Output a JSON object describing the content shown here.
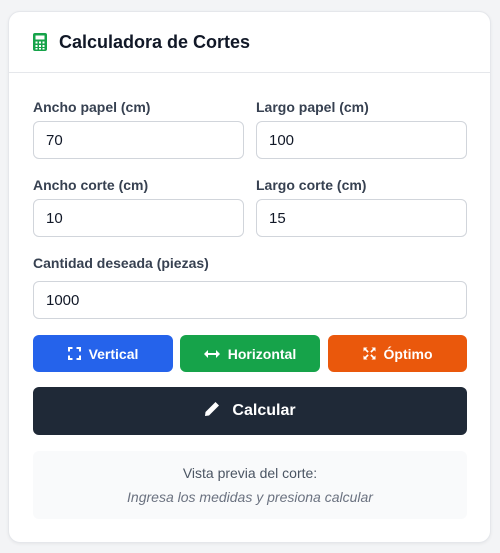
{
  "header": {
    "icon": "calculator-icon",
    "title": "Calculadora de Cortes",
    "icon_color": "#16a34a"
  },
  "form": {
    "paper_width": {
      "label": "Ancho papel (cm)",
      "value": "70"
    },
    "paper_length": {
      "label": "Largo papel (cm)",
      "value": "100"
    },
    "cut_width": {
      "label": "Ancho corte (cm)",
      "value": "10"
    },
    "cut_length": {
      "label": "Largo corte (cm)",
      "value": "15"
    },
    "quantity": {
      "label": "Cantidad deseada (piezas)",
      "value": "1000"
    }
  },
  "modes": {
    "vertical": {
      "label": "Vertical",
      "icon": "expand-icon",
      "color": "#2563eb"
    },
    "horizontal": {
      "label": "Horizontal",
      "icon": "arrows-horizontal-icon",
      "color": "#16a34a"
    },
    "optimo": {
      "label": "Óptimo",
      "icon": "compress-arrows-icon",
      "color": "#ea580c"
    }
  },
  "calculate": {
    "label": "Calcular",
    "icon": "pencil-icon",
    "color": "#1f2937"
  },
  "preview": {
    "title": "Vista previa del corte:",
    "hint": "Ingresa los medidas y presiona calcular"
  }
}
